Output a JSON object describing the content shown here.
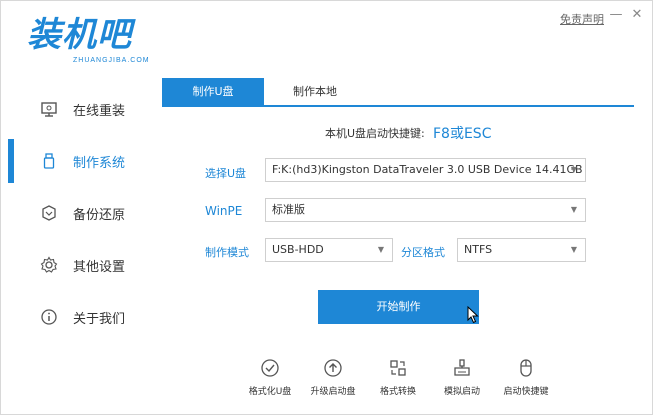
{
  "app": {
    "logo_text": "装机吧",
    "logo_sub": "ZHUANGJIBA.COM",
    "disclaimer": "免责声明",
    "minimize_glyph": "—",
    "close_glyph": "✕"
  },
  "sidebar": {
    "items": [
      {
        "label": "在线重装",
        "icon": "monitor-icon",
        "active": false
      },
      {
        "label": "制作系统",
        "icon": "usb-icon",
        "active": true
      },
      {
        "label": "备份还原",
        "icon": "backup-icon",
        "active": false
      },
      {
        "label": "其他设置",
        "icon": "gear-icon",
        "active": false
      },
      {
        "label": "关于我们",
        "icon": "info-icon",
        "active": false
      }
    ]
  },
  "tabs": [
    {
      "label": "制作U盘",
      "active": true
    },
    {
      "label": "制作本地",
      "active": false
    }
  ],
  "hotkey": {
    "label": "本机U盘启动快捷键:",
    "value": "F8或ESC"
  },
  "form": {
    "usb_label": "选择U盘",
    "usb_value": "F:K:(hd3)Kingston DataTraveler 3.0 USB Device 14.41GB",
    "winpe_label": "WinPE",
    "winpe_value": "标准版",
    "mode_label": "制作模式",
    "mode_value": "USB-HDD",
    "fs_label": "分区格式",
    "fs_value": "NTFS",
    "arrow_glyph": "▼"
  },
  "start_button": "开始制作",
  "tools": [
    {
      "label": "格式化U盘",
      "icon": "check-circle-icon"
    },
    {
      "label": "升级启动盘",
      "icon": "upload-circle-icon"
    },
    {
      "label": "格式转换",
      "icon": "convert-icon"
    },
    {
      "label": "模拟启动",
      "icon": "simulate-icon"
    },
    {
      "label": "启动快捷键",
      "icon": "mouse-icon"
    }
  ],
  "colors": {
    "accent": "#1e87d6",
    "text": "#333333",
    "border": "#cfcfcf"
  }
}
